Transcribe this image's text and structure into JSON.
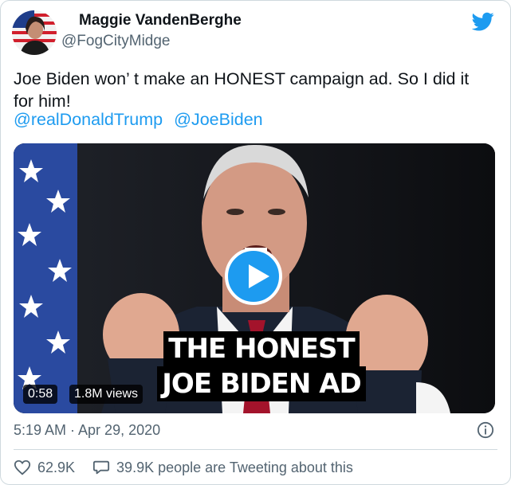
{
  "author": {
    "display_name": "Maggie VandenBerghe",
    "handle": "@FogCityMidge"
  },
  "tweet": {
    "text": "Joe Biden won’ t make an HONEST campaign ad. So I did it for him!",
    "mentions": [
      "@realDonaldTrump",
      "@JoeBiden"
    ],
    "timestamp": "5:19 AM · Apr 29, 2020"
  },
  "video": {
    "overlay_line1": "THE HONEST",
    "overlay_line2": "JOE BIDEN AD",
    "duration": "0:58",
    "views": "1.8M views"
  },
  "actions": {
    "likes": "62.9K",
    "tweeting": "39.9K people are Tweeting about this"
  },
  "icons": {
    "platform": "twitter-bird-icon",
    "info": "info-icon",
    "like": "heart-icon",
    "reply": "speech-bubble-icon",
    "play": "play-icon"
  },
  "colors": {
    "accent": "#1d9bf0",
    "text": "#0f1419",
    "muted": "#536471",
    "border": "#cfd9de"
  }
}
